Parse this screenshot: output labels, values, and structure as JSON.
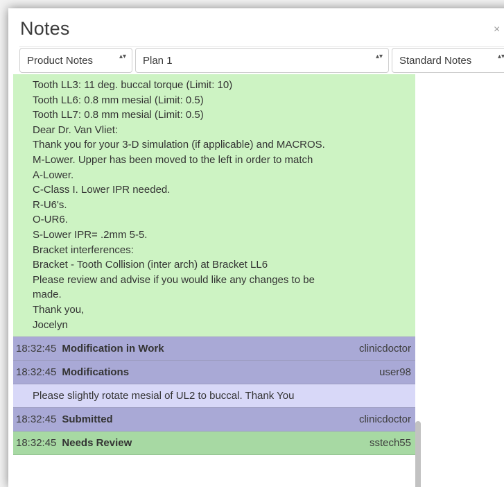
{
  "window": {
    "title": "Notes",
    "close_glyph": "×"
  },
  "filters": {
    "notes_type": "Product Notes",
    "plan": "Plan 1",
    "template": "Standard Notes",
    "select_arrows": "▴▾"
  },
  "note_lines": [
    "Tooth LL3: 11 deg. buccal torque (Limit: 10)",
    "Tooth LL6: 0.8 mm mesial (Limit: 0.5)",
    "Tooth LL7: 0.8 mm mesial (Limit: 0.5)",
    "Dear Dr. Van Vliet:",
    "Thank you for your 3-D simulation (if applicable) and MACROS.",
    "M-Lower. Upper has been moved to the left in order to match",
    "A-Lower.",
    "C-Class I. Lower IPR needed.",
    "R-U6's.",
    "O-UR6.",
    "S-Lower IPR= .2mm 5-5.",
    "Bracket interferences:",
    "Bracket - Tooth Collision (inter arch) at Bracket LL6",
    "Please review and advise if you would like any changes to be",
    "made.",
    "Thank you,",
    "Jocelyn"
  ],
  "entries": [
    {
      "time": "18:32:45",
      "status": "Modification in Work",
      "user": "clinicdoctor"
    },
    {
      "time": "18:32:45",
      "status": "Modifications",
      "user": "user98"
    },
    {
      "comment": "Please slightly rotate mesial of UL2 to buccal. Thank You"
    },
    {
      "time": "18:32:45",
      "status": "Submitted",
      "user": "clinicdoctor"
    },
    {
      "time": "18:32:45",
      "status": "Needs Review",
      "user": "sstech55"
    }
  ],
  "colors": {
    "note_bg": "#cdf3c3",
    "status_row_bg": "#a9a9d6",
    "comment_bg": "#d8d8f8",
    "review_row_bg": "#a7d9a3"
  }
}
